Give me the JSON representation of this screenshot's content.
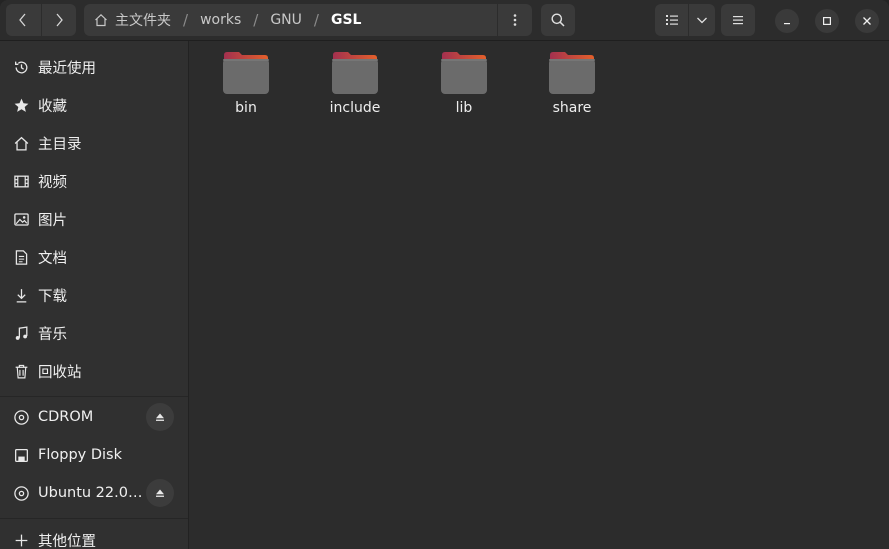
{
  "header": {
    "back_icon": "chevron-left-icon",
    "forward_icon": "chevron-right-icon",
    "breadcrumbs": [
      {
        "label": "主文件夹",
        "icon": "home-icon"
      },
      {
        "label": "works"
      },
      {
        "label": "GNU"
      },
      {
        "label": "GSL"
      }
    ],
    "separator": "/",
    "path_menu_icon": "vertical-dots-icon",
    "search_icon": "search-icon",
    "view_icon": "list-view-icon",
    "view_dropdown_icon": "chevron-down-icon",
    "menu_icon": "hamburger-menu-icon",
    "window_controls": [
      "minimize-icon",
      "maximize-icon",
      "close-icon"
    ]
  },
  "sidebar": {
    "places": [
      {
        "label": "最近使用",
        "icon": "clock-icon"
      },
      {
        "label": "收藏",
        "icon": "star-icon"
      },
      {
        "label": "主目录",
        "icon": "home-icon"
      },
      {
        "label": "视频",
        "icon": "film-icon"
      },
      {
        "label": "图片",
        "icon": "picture-icon"
      },
      {
        "label": "文档",
        "icon": "document-icon"
      },
      {
        "label": "下载",
        "icon": "download-icon"
      },
      {
        "label": "音乐",
        "icon": "music-icon"
      },
      {
        "label": "回收站",
        "icon": "trash-icon"
      }
    ],
    "devices": [
      {
        "label": "CDROM",
        "icon": "disc-icon",
        "eject": true
      },
      {
        "label": "Floppy Disk",
        "icon": "floppy-icon",
        "eject": false
      },
      {
        "label": "Ubuntu 22.0…",
        "icon": "disc-icon",
        "eject": true
      }
    ],
    "other": {
      "label": "其他位置",
      "icon": "plus-icon"
    }
  },
  "files": [
    {
      "name": "bin"
    },
    {
      "name": "include"
    },
    {
      "name": "lib"
    },
    {
      "name": "share"
    }
  ],
  "colors": {
    "folder_tab_left": "#a3304f",
    "folder_tab_right": "#e4602b",
    "folder_body": "#6b6b6b",
    "background": "#2c2c2c",
    "sidebar": "#303030"
  }
}
